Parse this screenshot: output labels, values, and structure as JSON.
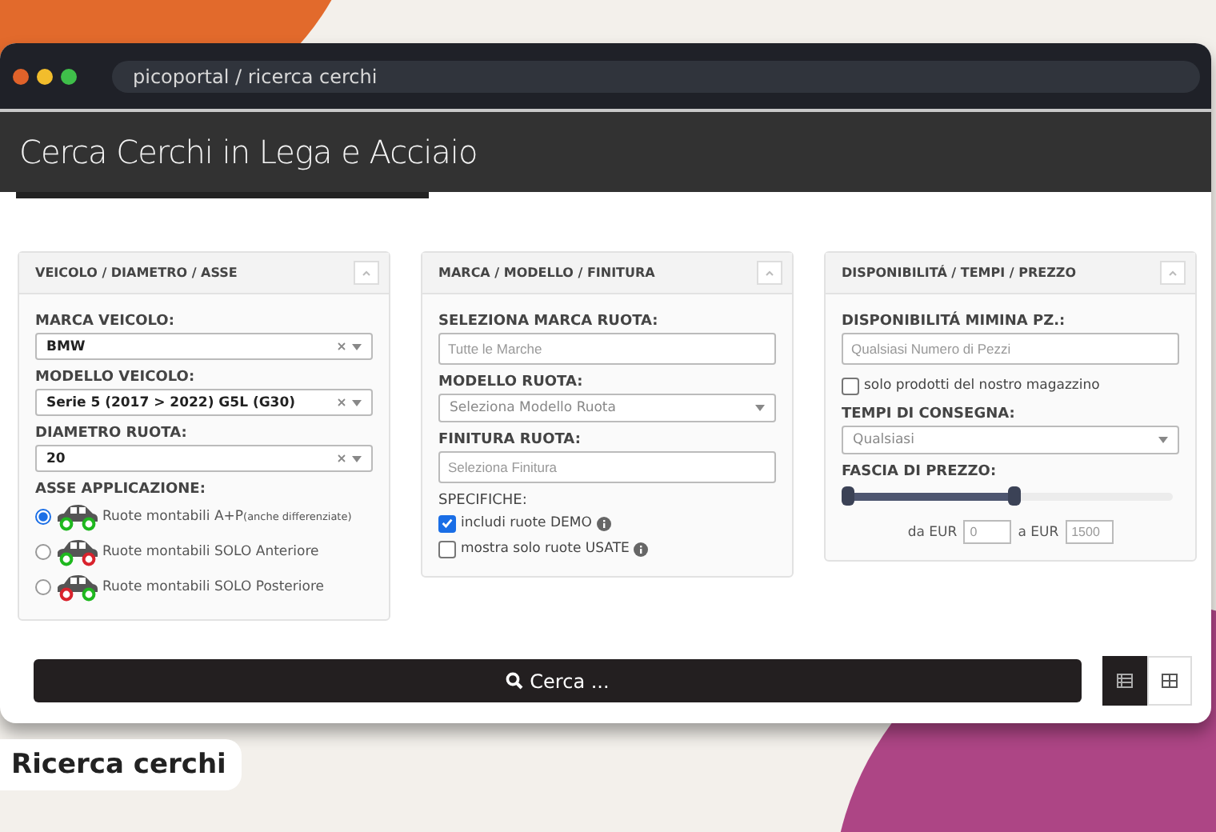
{
  "browser": {
    "address": "picoportal / ricerca cerchi"
  },
  "header": {
    "title": "Cerca Cerchi in Lega e Acciaio"
  },
  "panels": [
    {
      "title": "VEICOLO / DIAMETRO / ASSE",
      "fields": [
        {
          "kind": "select",
          "label": "MARCA VEICOLO:",
          "value": "BMW"
        },
        {
          "kind": "select",
          "label": "MODELLO VEICOLO:",
          "value": "Serie 5 (2017 > 2022) G5L (G30)"
        },
        {
          "kind": "select",
          "label": "DIAMETRO RUOTA:",
          "value": "20"
        },
        {
          "kind": "radios",
          "label": "ASSE APPLICAZIONE:",
          "options": [
            {
              "text": "Ruote montabili A+P",
              "note": "(anche differenziate)",
              "selected": true,
              "wheels": [
                {
                  "color": "#1fb81f"
                },
                {
                  "color": "#1fb81f"
                }
              ]
            },
            {
              "text": "Ruote montabili SOLO Anteriore",
              "selected": false,
              "wheels": [
                {
                  "color": "#1fb81f"
                },
                {
                  "color": "#d9232d"
                }
              ]
            },
            {
              "text": "Ruote montabili SOLO Posteriore",
              "selected": false,
              "wheels": [
                {
                  "color": "#d9232d"
                },
                {
                  "color": "#1fb81f"
                }
              ]
            }
          ]
        }
      ]
    },
    {
      "title": "MARCA / MODELLO / FINITURA",
      "fields": [
        {
          "kind": "input",
          "label": "SELEZIONA MARCA RUOTA:",
          "placeholder": "Tutte le Marche"
        },
        {
          "kind": "dropdown",
          "label": "MODELLO RUOTA:",
          "placeholder": "Seleziona Modello Ruota"
        },
        {
          "kind": "input",
          "label": "FINITURA RUOTA:",
          "placeholder": "Seleziona Finitura"
        },
        {
          "kind": "checks",
          "label": "SPECIFICHE:",
          "options": [
            {
              "text": "includi ruote DEMO",
              "checked": true,
              "info": true
            },
            {
              "text": "mostra solo ruote USATE",
              "checked": false,
              "info": true
            }
          ]
        }
      ]
    },
    {
      "title": "DISPONIBILITÁ / TEMPI / PREZZO",
      "fields": [
        {
          "kind": "input",
          "label": "DISPONIBILITÁ MIMINA PZ.:",
          "placeholder": "Qualsiasi Numero di Pezzi"
        },
        {
          "kind": "checks",
          "options": [
            {
              "text": "solo prodotti del nostro magazzino",
              "checked": false,
              "info": false
            }
          ]
        },
        {
          "kind": "dropdown",
          "label": "TEMPI DI CONSEGNA:",
          "placeholder": "Qualsiasi"
        },
        {
          "kind": "range",
          "label": "FASCIA DI PREZZO:",
          "thumbs": [
            {
              "level": 0
            },
            {
              "level": 0.51
            }
          ],
          "from_label": "da EUR",
          "from_placeholder": "0",
          "to_label": "a EUR",
          "to_placeholder": "1500"
        }
      ]
    }
  ],
  "search_button": {
    "label": "Cerca ..."
  },
  "view_toggle": [
    {
      "kind": "list",
      "selected": true
    },
    {
      "kind": "grid",
      "selected": false
    }
  ],
  "caption": "Ricerca cerchi"
}
